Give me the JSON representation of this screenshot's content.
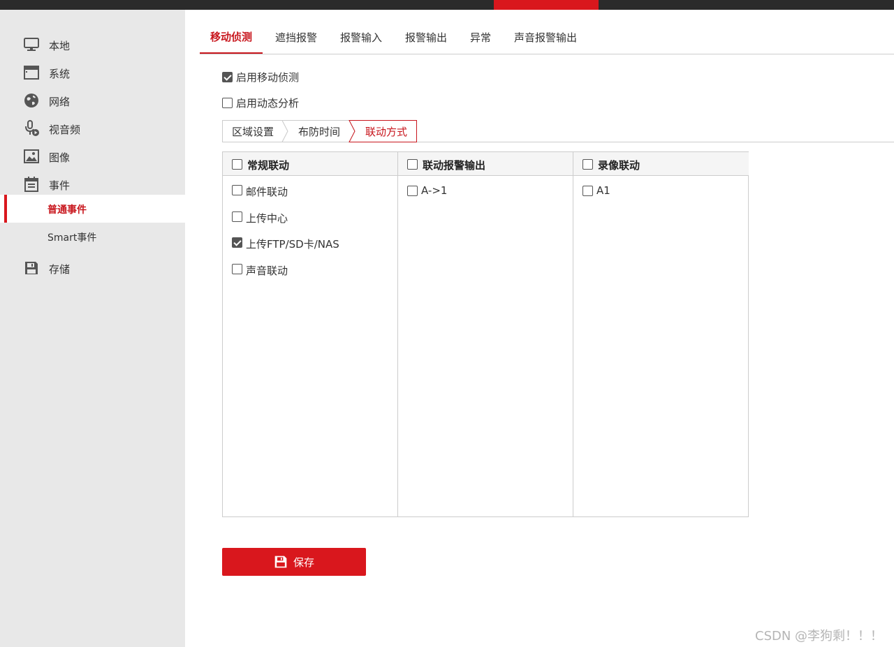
{
  "sidebar": {
    "items": [
      {
        "label": "本地",
        "icon": "monitor-icon"
      },
      {
        "label": "系统",
        "icon": "window-icon"
      },
      {
        "label": "网络",
        "icon": "globe-icon"
      },
      {
        "label": "视音频",
        "icon": "microphone-camera-icon"
      },
      {
        "label": "图像",
        "icon": "image-icon"
      },
      {
        "label": "事件",
        "icon": "calendar-icon"
      },
      {
        "label": "存储",
        "icon": "floppy-disk-icon"
      }
    ],
    "sub_items": [
      {
        "label": "普通事件",
        "active": true
      },
      {
        "label": "Smart事件",
        "active": false
      }
    ]
  },
  "tabs": [
    {
      "label": "移动侦测",
      "active": true
    },
    {
      "label": "遮挡报警"
    },
    {
      "label": "报警输入"
    },
    {
      "label": "报警输出"
    },
    {
      "label": "异常"
    },
    {
      "label": "声音报警输出"
    }
  ],
  "options": {
    "enable_motion": {
      "label": "启用移动侦测",
      "checked": true
    },
    "enable_dynamic": {
      "label": "启用动态分析",
      "checked": false
    }
  },
  "steps": [
    {
      "label": "区域设置"
    },
    {
      "label": "布防时间"
    },
    {
      "label": "联动方式",
      "active": true
    }
  ],
  "linkage": {
    "columns": [
      {
        "title": "常规联动",
        "items": [
          {
            "label": "邮件联动",
            "checked": false
          },
          {
            "label": "上传中心",
            "checked": false
          },
          {
            "label": "上传FTP/SD卡/NAS",
            "checked": true
          },
          {
            "label": "声音联动",
            "checked": false
          }
        ]
      },
      {
        "title": "联动报警输出",
        "items": [
          {
            "label": "A->1",
            "checked": false
          }
        ]
      },
      {
        "title": "录像联动",
        "items": [
          {
            "label": "A1",
            "checked": false
          }
        ]
      }
    ]
  },
  "save_button": {
    "label": "保存"
  },
  "watermark": "CSDN @李狗剩！！！",
  "colors": {
    "accent": "#d9171d",
    "sidebar_bg": "#e8e8e8",
    "topbar": "#2b2b2b"
  }
}
